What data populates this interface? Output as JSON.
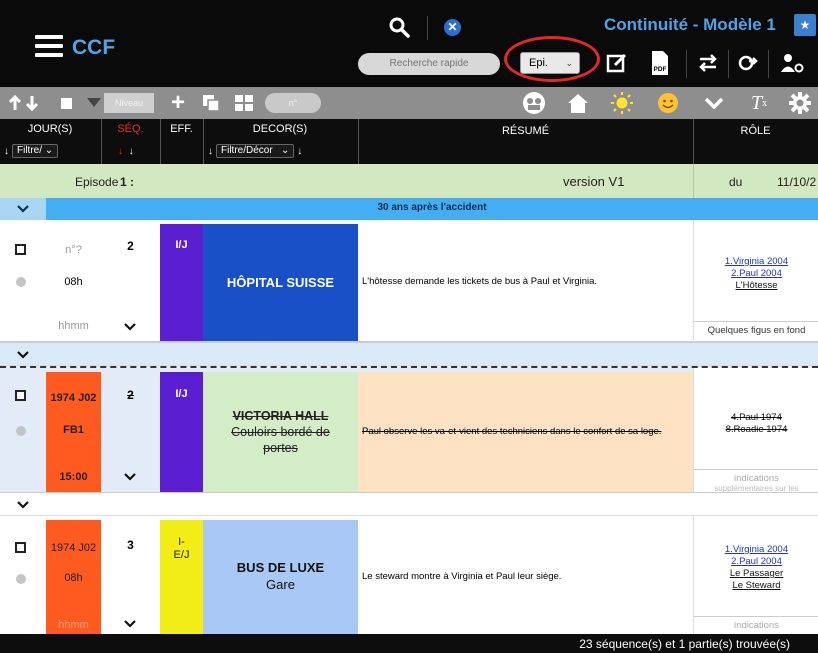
{
  "app": {
    "name": "CCF",
    "title": "Continuité - Modèle 1"
  },
  "search": {
    "placeholder": "Recherche rapide"
  },
  "episode_select": {
    "value": "Epi."
  },
  "icons": {
    "menu": "hamburger-icon",
    "search": "search-icon",
    "clear": "clear-icon",
    "star": "star-icon",
    "edit": "edit-icon",
    "pdf": "pdf-icon",
    "swap": "swap-icon",
    "share": "share-icon",
    "user_settings": "user-settings-icon",
    "sort": "sort-arrows-icon",
    "add": "plus-icon",
    "duplicate": "duplicate-icon",
    "grid": "grid-icon",
    "people": "people-icon",
    "home": "home-icon",
    "sun": "sun-icon",
    "smiley": "smiley-icon",
    "chevron": "chevron-down-icon",
    "clear_format": "clear-format-icon",
    "settings": "gear-icon"
  },
  "toolbar2": {
    "level_pill": "Niveau",
    "number_pill": "n°"
  },
  "columns": {
    "jour": "JOUR(S)",
    "jour_filter": "Filtre/",
    "seq": "SÉQ.",
    "eff": "EFF.",
    "decor": "DECOR(S)",
    "decor_filter": "Filtre/Décor",
    "resume": "RÉSUMÉ",
    "role": "RÔLE"
  },
  "episode_band": {
    "label": "Episode",
    "number": "1 :",
    "version": "version V1",
    "du": "du",
    "date": "11/10/2"
  },
  "part_header": {
    "label": "30 ans après l'accident"
  },
  "colors": {
    "accent": "#4fa3e8",
    "red_ring": "#e32a22",
    "eff_purple": "#5b1fd1",
    "decor_blue": "#1a50c7",
    "jour_orange": "#ff5a1f"
  },
  "rows": [
    {
      "jour": "n°?",
      "hour": "08h",
      "hhmm": "hhmm",
      "seq": "2",
      "eff": "I/J",
      "decor": "HÔPITAL SUISSE",
      "resume": "L'hôtesse demande les tickets de bus à Paul et Virginia.",
      "roles": [
        "1.Virginia 2004",
        "2.Paul 2004",
        "L'Hôtesse"
      ],
      "role_footer": "Quelques figus en fond"
    },
    {
      "jour": "1974 J02",
      "hour": "FB1",
      "hhmm": "15:00",
      "seq": "2",
      "eff": "I/J",
      "decor": "VICTORIA HALL",
      "decor_sub": "Couloirs bordé de",
      "decor_sub2": "portes",
      "resume": "Paul observe les va-et-vient des techniciens dans le confort de sa loge.",
      "roles": [
        "4.Paul 1974",
        "8.Roadie 1974"
      ],
      "role_footer": "indications",
      "role_footer2": "supplémentaires sur les"
    },
    {
      "jour": "1974 J02",
      "hour": "08h",
      "hhmm": "hhmm",
      "seq": "3",
      "eff": "I-",
      "eff2": "E/J",
      "decor": "BUS DE LUXE",
      "decor_sub": "Gare",
      "resume": "Le steward montre à Virginia et Paul leur siège.",
      "roles": [
        "1.Virginia 2004",
        "2.Paul 2004",
        "Le Passager",
        "Le Steward"
      ],
      "role_footer": "indications"
    }
  ],
  "footer": {
    "status": "23 séquence(s) et 1 partie(s) trouvée(s)"
  }
}
